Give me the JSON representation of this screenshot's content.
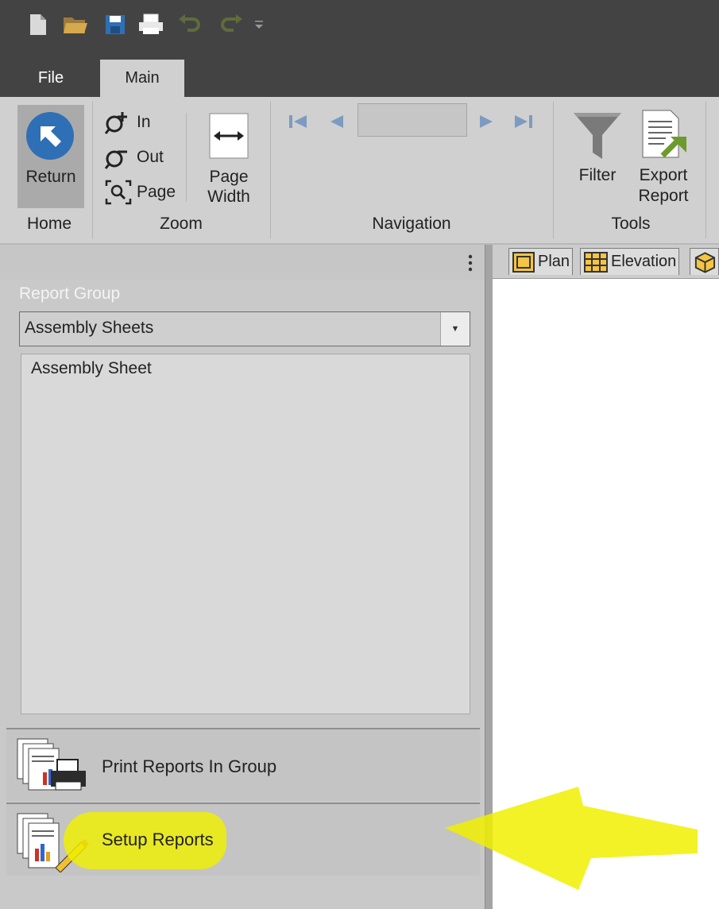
{
  "quick_access": {
    "icons": [
      "new-file-icon",
      "open-folder-icon",
      "save-icon",
      "print-icon",
      "undo-icon",
      "redo-icon",
      "customize-qat-icon"
    ]
  },
  "ribbon_tabs": [
    {
      "label": "File"
    },
    {
      "label": "Main"
    }
  ],
  "ribbon": {
    "home": {
      "return_label": "Return",
      "group_label": "Home"
    },
    "zoom": {
      "in_label": "In",
      "out_label": "Out",
      "page_label": "Page",
      "page_width_label": "Page Width",
      "group_label": "Zoom"
    },
    "navigation": {
      "group_label": "Navigation",
      "page_value": ""
    },
    "tools": {
      "filter_label": "Filter",
      "export_label": "Export Report",
      "group_label": "Tools"
    }
  },
  "panel": {
    "report_group_label": "Report Group",
    "report_group_value": "Assembly Sheets",
    "reports": [
      "Assembly Sheet"
    ],
    "print_button_label": "Print Reports In Group",
    "setup_button_label": "Setup Reports"
  },
  "doc_tabs": [
    {
      "label": "Plan"
    },
    {
      "label": "Elevation"
    }
  ],
  "colors": {
    "accent_blue": "#2f6fb5",
    "highlight": "#f0f000",
    "ribbon_bg": "#d0d0d0",
    "title_bar": "#434343"
  }
}
